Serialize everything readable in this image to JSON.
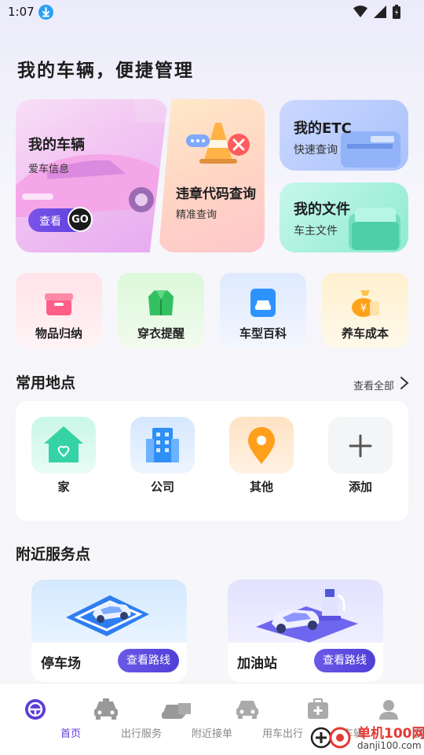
{
  "status_bar": {
    "time": "1:07"
  },
  "page_title": "我的车辆，便捷管理",
  "hero": {
    "vehicle": {
      "title": "我的车辆",
      "subtitle": "爱车信息",
      "button": "查看",
      "badge": "GO"
    },
    "violation": {
      "title": "违章代码查询",
      "subtitle": "精准查询"
    },
    "etc": {
      "title": "我的ETC",
      "subtitle": "快速查询"
    },
    "files": {
      "title": "我的文件",
      "subtitle": "车主文件"
    }
  },
  "quick_tiles": [
    {
      "label": "物品归纳",
      "icon": "gift-box-icon",
      "color": "#ff5f86"
    },
    {
      "label": "穿衣提醒",
      "icon": "jacket-icon",
      "color": "#33c061"
    },
    {
      "label": "车型百科",
      "icon": "car-document-icon",
      "color": "#2f93ff"
    },
    {
      "label": "养车成本",
      "icon": "money-bag-icon",
      "color": "#ffa21b"
    }
  ],
  "common_places": {
    "title": "常用地点",
    "see_all": "查看全部",
    "items": [
      {
        "label": "家",
        "icon": "home-icon"
      },
      {
        "label": "公司",
        "icon": "building-icon"
      },
      {
        "label": "其他",
        "icon": "location-pin-icon"
      },
      {
        "label": "添加",
        "icon": "plus-icon"
      }
    ]
  },
  "nearby": {
    "title": "附近服务点",
    "items": [
      {
        "label": "停车场",
        "button": "查看路线",
        "icon": "parking-car-icon"
      },
      {
        "label": "加油站",
        "button": "查看路线",
        "icon": "fuel-station-icon"
      }
    ]
  },
  "bottom_nav": [
    {
      "label": "首页",
      "icon": "steering-wheel-icon",
      "active": true
    },
    {
      "label": "出行服务",
      "icon": "taxi-icon",
      "active": false
    },
    {
      "label": "附近接单",
      "icon": "car-chat-icon",
      "active": false
    },
    {
      "label": "用车出行",
      "icon": "car-icon",
      "active": false
    },
    {
      "label": "车辆",
      "icon": "first-aid-kit-icon",
      "active": false
    },
    {
      "label": "我的",
      "icon": "user-icon",
      "active": false
    }
  ],
  "watermark": {
    "brand": "单机100网",
    "url": "danji100.com"
  },
  "colors": {
    "accent": "#5a3fd9",
    "active_nav": "#5b3bd8",
    "inactive_nav": "#9a9a9a"
  }
}
